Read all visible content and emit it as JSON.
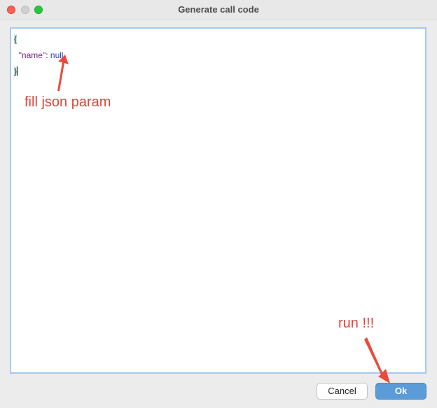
{
  "window": {
    "title": "Generate call code"
  },
  "editor": {
    "open_brace": "{",
    "key": "\"name\"",
    "colon": ": ",
    "value": "null",
    "close_brace": "}"
  },
  "annotations": {
    "fill_label": "fill json param",
    "run_label": "run !!!"
  },
  "buttons": {
    "cancel": "Cancel",
    "ok": "Ok"
  },
  "colors": {
    "annotation": "#e0453a",
    "ok_button": "#5b9bd8",
    "editor_border": "#a6c8ef"
  }
}
